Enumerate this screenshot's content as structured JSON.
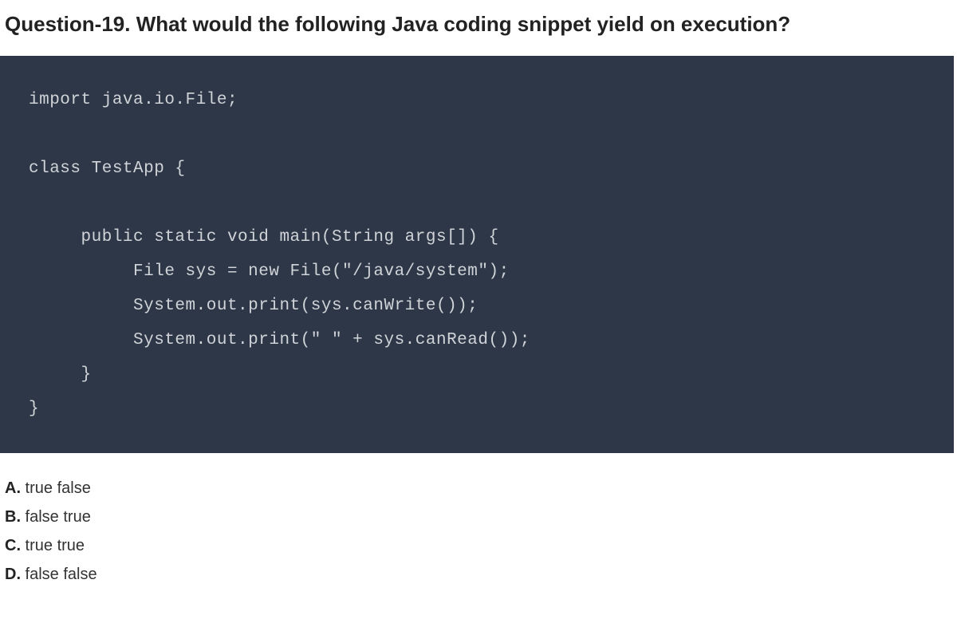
{
  "question": {
    "title": "Question-19. What would the following Java coding snippet yield on execution?"
  },
  "code": {
    "line1": "import java.io.File;",
    "line2": "",
    "line3": "class TestApp {",
    "line4": "",
    "line5": "     public static void main(String args[]) {",
    "line6": "          File sys = new File(\"/java/system\");",
    "line7": "          System.out.print(sys.canWrite());",
    "line8": "          System.out.print(\" \" + sys.canRead());",
    "line9": "     }",
    "line10": "}"
  },
  "options": [
    {
      "letter": "A.",
      "text": " true false"
    },
    {
      "letter": "B.",
      "text": " false true"
    },
    {
      "letter": "C.",
      "text": " true true"
    },
    {
      "letter": "D.",
      "text": " false false"
    }
  ]
}
